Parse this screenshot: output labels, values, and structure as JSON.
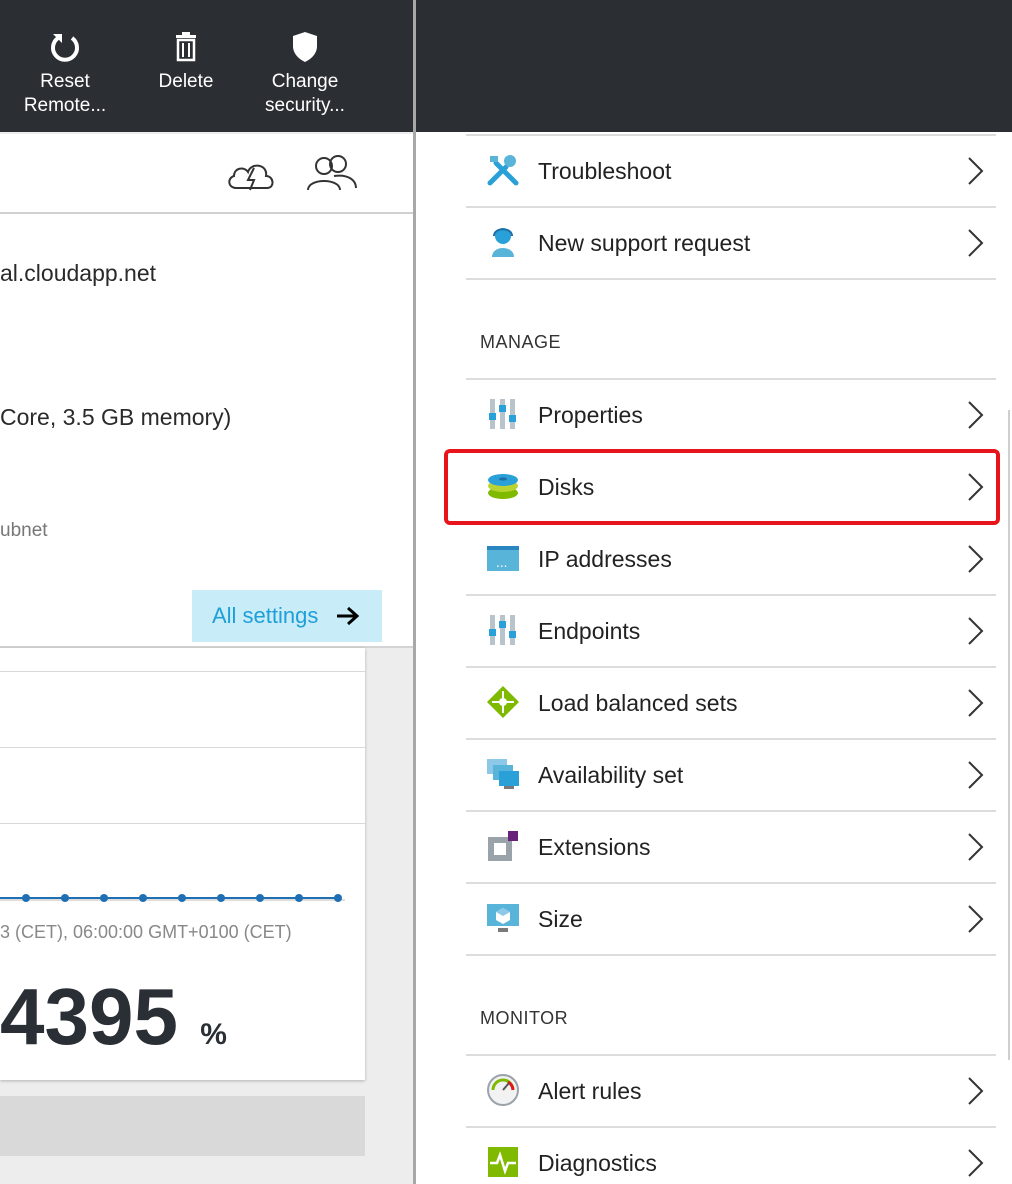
{
  "toolbar": {
    "commands": [
      {
        "label_line1": "Reset",
        "label_line2": "Remote...",
        "icon": "refresh-icon"
      },
      {
        "label_line1": "Delete",
        "label_line2": "",
        "icon": "trash-icon"
      },
      {
        "label_line1": "Change",
        "label_line2": "security...",
        "icon": "shield-icon"
      }
    ]
  },
  "icons_row": [
    "cloud-lightning-icon",
    "users-icon"
  ],
  "essentials": {
    "dns_name": "al.cloudapp.net",
    "size": " Core, 3.5 GB memory)",
    "subnet": "ubnet",
    "all_settings_label": "All settings"
  },
  "monitoring": {
    "axis_label": "3 (CET), 06:00:00 GMT+0100 (CET)",
    "big_value": "4395",
    "big_unit": "%"
  },
  "menu": {
    "support_items": [
      {
        "label": "Troubleshoot",
        "icon": "tools-icon"
      },
      {
        "label": "New support request",
        "icon": "support-person-icon"
      }
    ],
    "manage_title": "MANAGE",
    "manage_items": [
      {
        "label": "Properties",
        "icon": "sliders-icon"
      },
      {
        "label": "Disks",
        "icon": "disk-icon",
        "highlighted": true
      },
      {
        "label": "IP addresses",
        "icon": "ip-window-icon"
      },
      {
        "label": "Endpoints",
        "icon": "sliders-icon"
      },
      {
        "label": "Load balanced sets",
        "icon": "load-balancer-icon"
      },
      {
        "label": "Availability set",
        "icon": "availability-set-icon"
      },
      {
        "label": "Extensions",
        "icon": "extensions-icon"
      },
      {
        "label": "Size",
        "icon": "monitor-cube-icon"
      }
    ],
    "monitor_title": "MONITOR",
    "monitor_items": [
      {
        "label": "Alert rules",
        "icon": "gauge-icon"
      },
      {
        "label": "Diagnostics",
        "icon": "diagnostics-icon"
      }
    ]
  },
  "colors": {
    "command_bar": "#2b2e33",
    "accent_blue": "#1e9fd8",
    "highlight_red": "#e8141c"
  }
}
